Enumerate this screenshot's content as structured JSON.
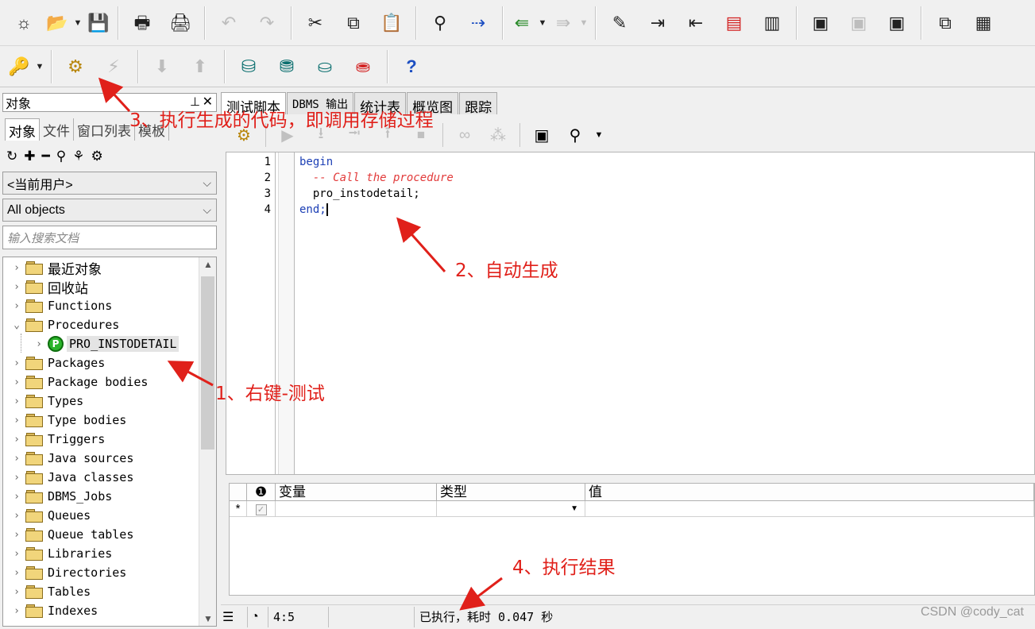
{
  "toolbar1": {
    "icons": [
      "new-icon",
      "open-icon",
      "save-icon",
      "print-icon",
      "print-preview-icon",
      "undo-icon",
      "redo-icon",
      "cut-icon",
      "copy-icon",
      "paste-icon",
      "find-icon",
      "find-next-icon",
      "import-icon",
      "export-icon",
      "comment-icon",
      "indent-icon",
      "unindent-icon",
      "upper-icon",
      "lower-icon",
      "db-icon-1",
      "db-icon-2",
      "db-icon-3",
      "windows-icon",
      "grid-icon"
    ]
  },
  "toolbar2": {
    "icons": [
      "key-icon",
      "execute-gear-icon",
      "break-icon",
      "commit-icon",
      "rollback-icon",
      "session-icon",
      "sql-icon",
      "connect-icon",
      "disconnect-icon",
      "help-icon"
    ],
    "help_glyph": "?"
  },
  "left_panel": {
    "title": "对象",
    "tabs": [
      "对象",
      "文件",
      "窗口列表",
      "模板"
    ],
    "user_combo": "<当前用户>",
    "filter_combo": "All objects",
    "search_placeholder": "输入搜索文档",
    "tree": [
      {
        "label": "最近对象",
        "expanded": false
      },
      {
        "label": "回收站",
        "expanded": false
      },
      {
        "label": "Functions",
        "expanded": false
      },
      {
        "label": "Procedures",
        "expanded": true
      },
      {
        "label": "PRO_INSTODETAIL",
        "child": true,
        "badge": "P"
      },
      {
        "label": "Packages",
        "expanded": false
      },
      {
        "label": "Package bodies",
        "expanded": false
      },
      {
        "label": "Types",
        "expanded": false
      },
      {
        "label": "Type bodies",
        "expanded": false
      },
      {
        "label": "Triggers",
        "expanded": false
      },
      {
        "label": "Java sources",
        "expanded": false
      },
      {
        "label": "Java classes",
        "expanded": false
      },
      {
        "label": "DBMS_Jobs",
        "expanded": false
      },
      {
        "label": "Queues",
        "expanded": false
      },
      {
        "label": "Queue tables",
        "expanded": false
      },
      {
        "label": "Libraries",
        "expanded": false
      },
      {
        "label": "Directories",
        "expanded": false
      },
      {
        "label": "Tables",
        "expanded": false
      },
      {
        "label": "Indexes",
        "expanded": false
      }
    ]
  },
  "editor": {
    "tabs": [
      "测试脚本",
      "DBMS 输出",
      "统计表",
      "概览图",
      "跟踪"
    ],
    "line_numbers": [
      "1",
      "2",
      "3",
      "4"
    ],
    "code": {
      "l1": "begin",
      "l2": "  -- Call the procedure",
      "l3": "  pro_instodetail;",
      "l4": "end;"
    }
  },
  "grid": {
    "headers": [
      "变量",
      "类型",
      "值"
    ],
    "new_row_marker": "*"
  },
  "status": {
    "position": "4:5",
    "message": "已执行，耗时 0.047 秒"
  },
  "annotations": {
    "a1": "1、右键-测试",
    "a2": "2、自动生成",
    "a3": "3、执行生成的代码，即调用存储过程",
    "a4": "4、执行结果"
  },
  "watermark": "CSDN @cody_cat",
  "colors": {
    "annotation": "#e0201a",
    "keyword": "#1c3fb5",
    "comment": "#e23b3b"
  }
}
